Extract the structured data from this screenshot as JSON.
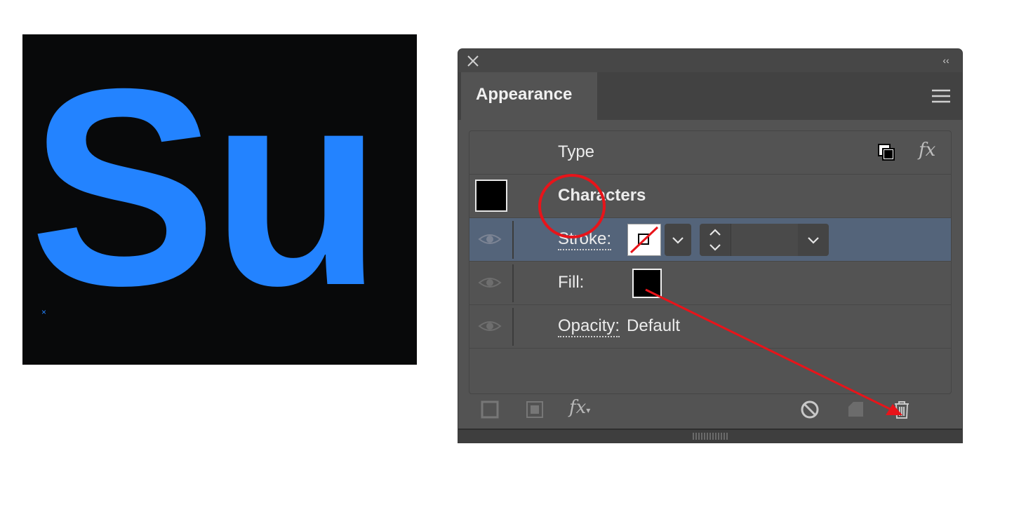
{
  "artwork": {
    "text": "Su",
    "text_color": "#2383ff",
    "background": "#08090a"
  },
  "panel": {
    "tab_label": "Appearance",
    "collapse_glyph": "‹‹",
    "rows": {
      "type_label": "Type",
      "characters_label": "Characters",
      "stroke_label": "Stroke:",
      "fill_label": "Fill:",
      "opacity_label": "Opacity:",
      "opacity_value": "Default"
    },
    "icons": {
      "close": "close-icon",
      "menu": "hamburger-menu-icon",
      "visibility": "eye-icon",
      "duplicate": "duplicate-icon",
      "fx": "fx-icon",
      "delete": "trash-icon"
    },
    "fx_glyph": "fx",
    "colors": {
      "selected_row": "#54647a",
      "panel_bg": "#535353",
      "annotation": "#e8141a"
    }
  }
}
